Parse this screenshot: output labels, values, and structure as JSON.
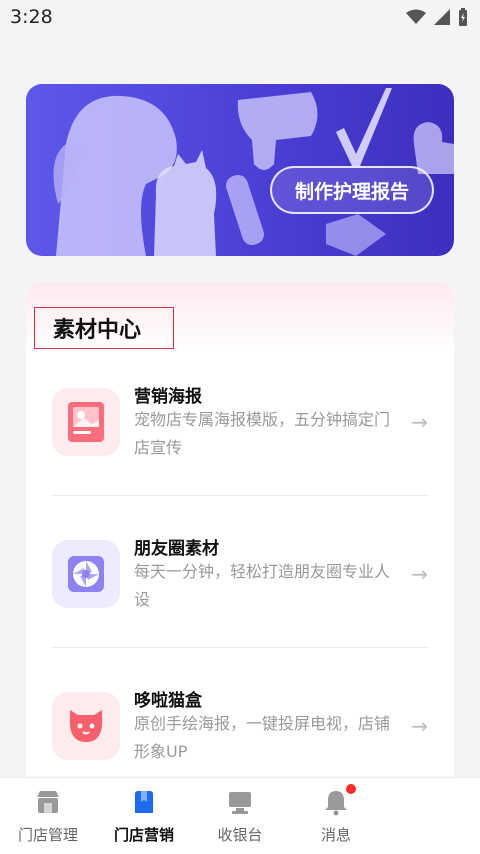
{
  "status_bar": {
    "time": "3:28"
  },
  "banner": {
    "button_label": "制作护理报告"
  },
  "materials": {
    "title": "素材中心",
    "items": [
      {
        "title": "营销海报",
        "desc": "宠物店专属海报模版，五分钟搞定门店宣传",
        "arrow": "→",
        "icon": "poster-icon"
      },
      {
        "title": "朋友圈素材",
        "desc": "每天一分钟，轻松打造朋友圈专业人设",
        "arrow": "→",
        "icon": "camera-shutter-icon"
      },
      {
        "title": "哆啦猫盒",
        "desc": "原创手绘海报，一键投屏电视，店铺形象UP",
        "arrow": "→",
        "icon": "cat-box-icon"
      }
    ]
  },
  "tabbar": {
    "tabs": [
      {
        "label": "门店管理",
        "icon": "store-icon"
      },
      {
        "label": "门店营销",
        "icon": "marketing-icon",
        "active": true
      },
      {
        "label": "收银台",
        "icon": "cashier-icon"
      },
      {
        "label": "消息",
        "icon": "bell-icon",
        "has_badge": true
      }
    ]
  },
  "colors": {
    "accent": "#1e6bf0",
    "banner": "#4b3fd5",
    "badge": "#ff2a2a"
  }
}
